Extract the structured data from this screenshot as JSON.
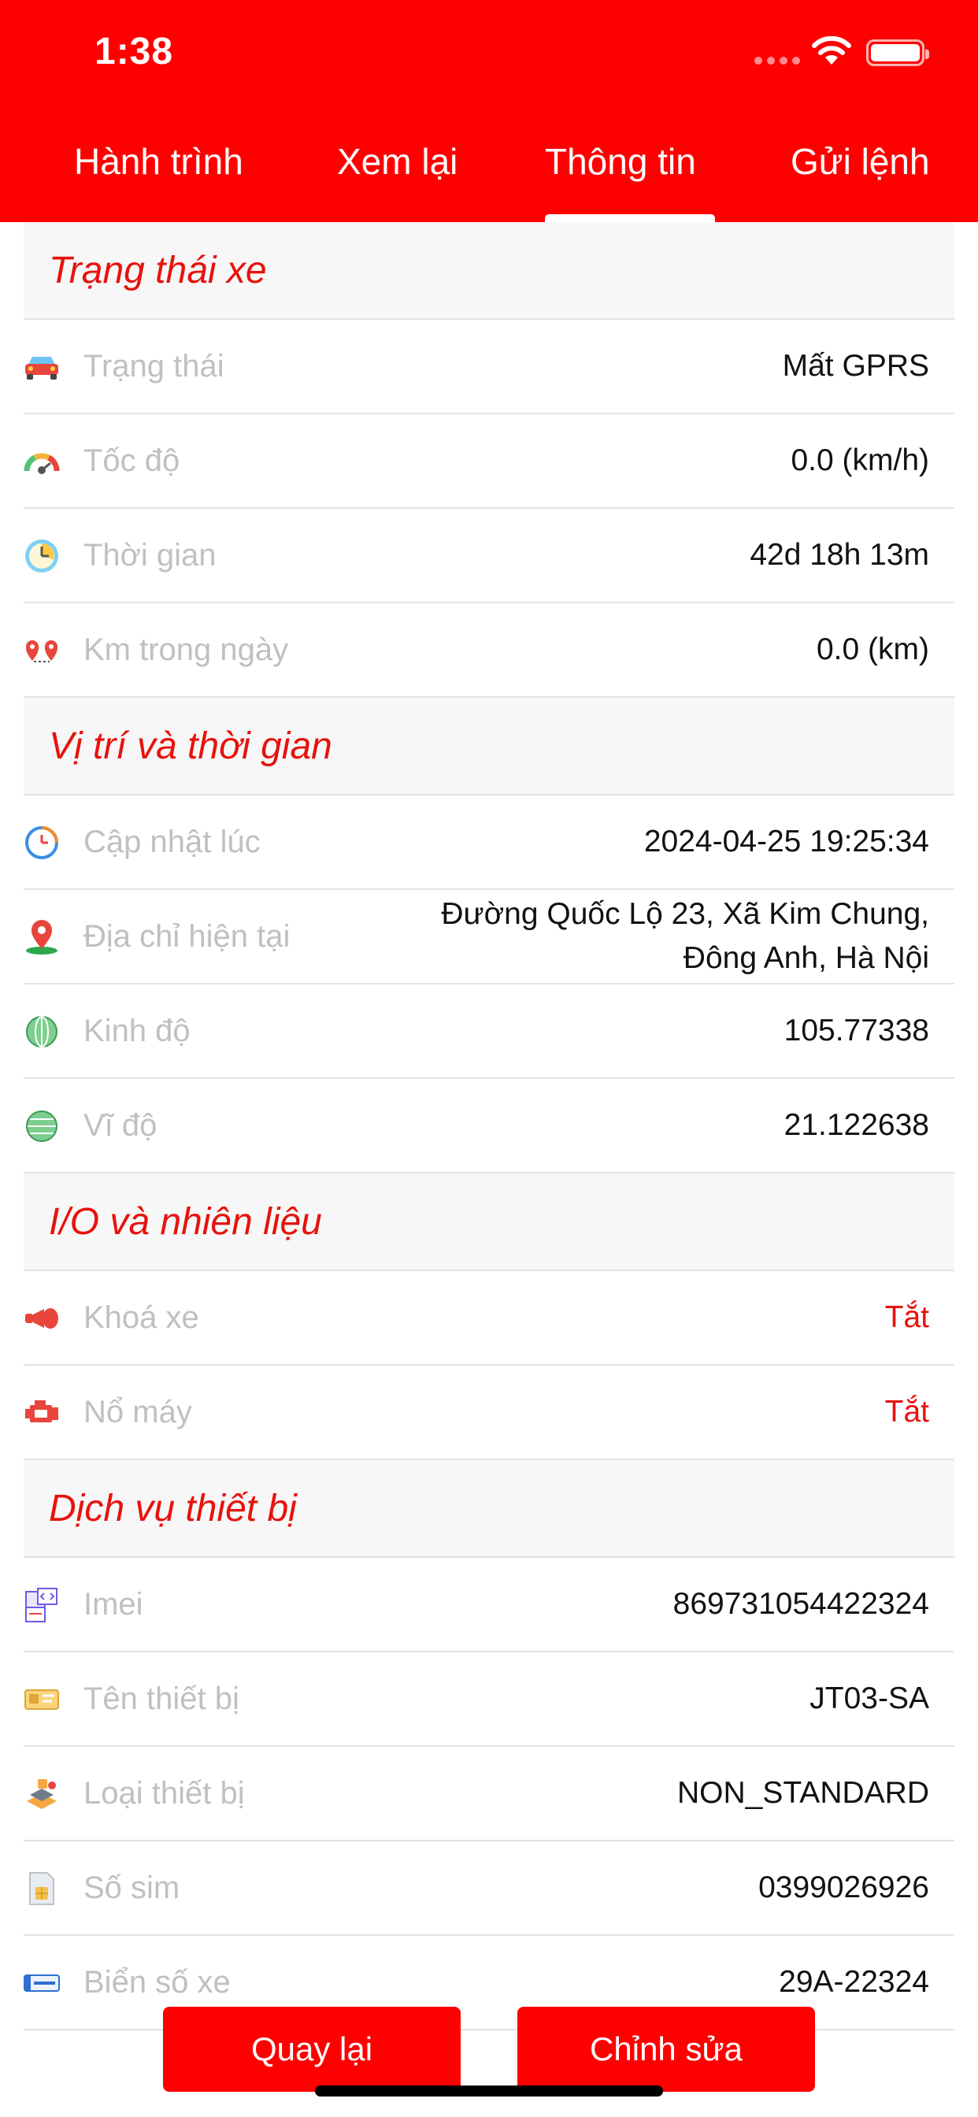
{
  "status_bar": {
    "time": "1:38"
  },
  "tabs": [
    {
      "label": "Hành trình"
    },
    {
      "label": "Xem lại"
    },
    {
      "label": "Thông tin",
      "active": true
    },
    {
      "label": "Gửi lệnh"
    }
  ],
  "sections": {
    "vehicle_status": {
      "title": "Trạng thái xe",
      "rows": [
        {
          "label": "Trạng thái",
          "value": "Mất GPRS",
          "icon": "car-icon"
        },
        {
          "label": "Tốc độ",
          "value": "0.0 (km/h)",
          "icon": "speedometer-icon"
        },
        {
          "label": "Thời gian",
          "value": "42d 18h 13m",
          "icon": "clock-icon"
        },
        {
          "label": "Km trong ngày",
          "value": "0.0 (km)",
          "icon": "route-pins-icon"
        }
      ]
    },
    "location_time": {
      "title": "Vị trí và thời gian",
      "rows": [
        {
          "label": "Cập nhật lúc",
          "value": "2024-04-25 19:25:34",
          "icon": "update-clock-icon"
        },
        {
          "label": "Địa chỉ hiện tại",
          "value_line1": "Đường Quốc Lộ 23, Xã Kim Chung,",
          "value_line2": "Đông Anh, Hà Nội",
          "icon": "location-pin-icon"
        },
        {
          "label": "Kinh độ",
          "value": "105.77338",
          "icon": "longitude-globe-icon"
        },
        {
          "label": "Vĩ độ",
          "value": "21.122638",
          "icon": "latitude-globe-icon"
        }
      ]
    },
    "io_fuel": {
      "title": "I/O và nhiên liệu",
      "rows": [
        {
          "label": "Khoá xe",
          "value": "Tắt",
          "icon": "horn-lock-icon"
        },
        {
          "label": "Nổ máy",
          "value": "Tắt",
          "icon": "engine-icon"
        }
      ]
    },
    "device_service": {
      "title": "Dịch vụ thiết bị",
      "rows": [
        {
          "label": "Imei",
          "value": "869731054422324",
          "icon": "imei-code-icon"
        },
        {
          "label": "Tên thiết bị",
          "value": "JT03-SA",
          "icon": "device-card-icon"
        },
        {
          "label": "Loại thiết bị",
          "value": "NON_STANDARD",
          "icon": "device-type-icon"
        },
        {
          "label": "Số sim",
          "value": "0399026926",
          "icon": "sim-card-icon"
        },
        {
          "label": "Biển số xe",
          "value": "29A-22324",
          "icon": "license-plate-icon"
        }
      ]
    }
  },
  "buttons": {
    "back": "Quay lại",
    "edit": "Chỉnh sửa"
  },
  "colors": {
    "primary": "#ff0000",
    "accent_text": "#e8120c",
    "label_gray": "#c0c0c0"
  }
}
